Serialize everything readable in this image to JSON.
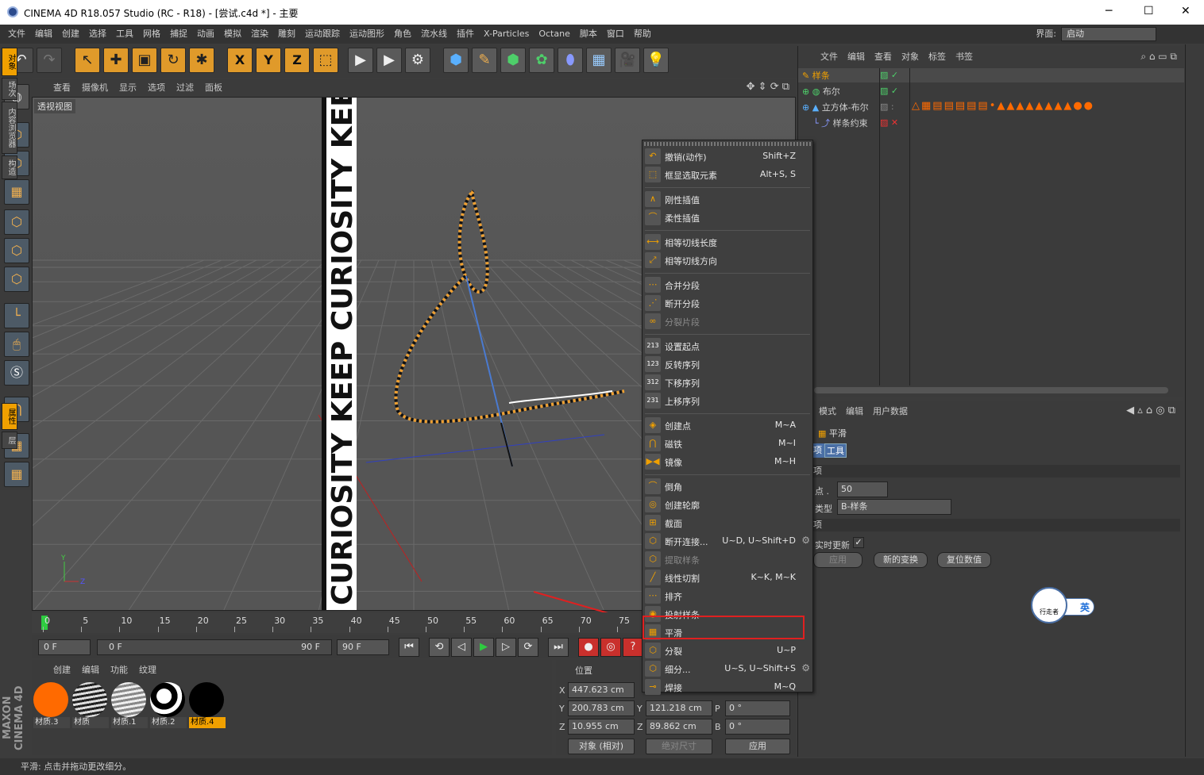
{
  "window": {
    "title": "CINEMA 4D R18.057 Studio (RC - R18) - [尝试.c4d *] - 主要",
    "min": "─",
    "max": "☐",
    "close": "✕"
  },
  "menu": [
    "文件",
    "编辑",
    "创建",
    "选择",
    "工具",
    "网格",
    "捕捉",
    "动画",
    "模拟",
    "渲染",
    "雕刻",
    "运动跟踪",
    "运动图形",
    "角色",
    "流水线",
    "插件",
    "X-Particles",
    "Octane",
    "脚本",
    "窗口",
    "帮助"
  ],
  "interface": {
    "label": "界面:",
    "value": "启动"
  },
  "toolbar": {
    "undo": "↶",
    "redo": "↷",
    "x": "X",
    "y": "Y",
    "z": "Z"
  },
  "viewport_menu": [
    "查看",
    "摄像机",
    "显示",
    "选项",
    "过滤",
    "面板"
  ],
  "viewport_label": "透视视图",
  "viewport_text": "CURIOSITY KEEP CURIOSITY KEEP CU",
  "timeline": {
    "ticks": [
      "0",
      "5",
      "10",
      "15",
      "20",
      "25",
      "30",
      "35",
      "40",
      "45",
      "50",
      "55",
      "60",
      "65",
      "70",
      "75"
    ]
  },
  "transport": {
    "current": "0 F",
    "start": "0 F",
    "end_slider": "90 F",
    "end": "90 F"
  },
  "materials": {
    "menu": [
      "创建",
      "编辑",
      "功能",
      "纹理"
    ],
    "items": [
      {
        "name": "材质.3",
        "color": "#ff6a00"
      },
      {
        "name": "材质",
        "color": "stripes"
      },
      {
        "name": "材质.1",
        "color": "stripes-light"
      },
      {
        "name": "材质.2",
        "color": "bw"
      },
      {
        "name": "材质.4",
        "color": "#000000",
        "selected": true
      }
    ]
  },
  "coords": {
    "header": "位置",
    "x": "447.623 cm",
    "y": "200.783 cm",
    "z": "10.955 cm",
    "sy": "121.218 cm",
    "sz": "89.862 cm",
    "p": "0 °",
    "b": "0 °",
    "mode": "对象 (相对)",
    "size_mode": "绝对尺寸",
    "apply": "应用",
    "labels": {
      "x": "X",
      "y": "Y",
      "z": "Z",
      "p": "P",
      "b": "B"
    }
  },
  "status": "平滑: 点击并拖动更改细分。",
  "maxon": "MAXON CINEMA 4D",
  "objects": {
    "menu": [
      "文件",
      "编辑",
      "查看",
      "对象",
      "标签",
      "书签"
    ],
    "items": [
      {
        "name": "样条"
      },
      {
        "name": "布尔"
      },
      {
        "name": "立方体-布尔"
      },
      {
        "name": "样条约束"
      }
    ]
  },
  "attributes": {
    "menu": [
      "模式",
      "编辑",
      "用户数据"
    ],
    "title": "平滑",
    "tabs": [
      "项",
      "工具"
    ],
    "section1": "项",
    "points_label": "点 .",
    "points_value": "50",
    "type_label": "类型",
    "type_value": "B-样条",
    "section2": "项",
    "realtime": "实时更新",
    "check": "✓",
    "apply": "应用",
    "new_transform": "新的变换",
    "reset": "复位数值"
  },
  "right_tabs": [
    "对象",
    "场次",
    "内容浏览器",
    "构造",
    "属性",
    "层"
  ],
  "ime": {
    "logo": "行走者",
    "lang": "英"
  },
  "context_menu": [
    {
      "label": "撤销(动作)",
      "shortcut": "Shift+Z",
      "icon": "↶"
    },
    {
      "label": "框显选取元素",
      "shortcut": "Alt+S, S",
      "icon": "⬚"
    },
    {
      "sep": true
    },
    {
      "label": "刚性插值",
      "shortcut": "",
      "icon": "∧"
    },
    {
      "label": "柔性插值",
      "shortcut": "",
      "icon": "⌒"
    },
    {
      "sep": true
    },
    {
      "label": "相等切线长度",
      "shortcut": "",
      "icon": "⟷"
    },
    {
      "label": "相等切线方向",
      "shortcut": "",
      "icon": "⤢"
    },
    {
      "sep": true
    },
    {
      "label": "合并分段",
      "shortcut": "",
      "icon": "⋯"
    },
    {
      "label": "断开分段",
      "shortcut": "",
      "icon": "⋰"
    },
    {
      "label": "分裂片段",
      "shortcut": "",
      "icon": "∞",
      "disabled": true
    },
    {
      "sep": true
    },
    {
      "label": "设置起点",
      "shortcut": "",
      "icon": "213"
    },
    {
      "label": "反转序列",
      "shortcut": "",
      "icon": "123"
    },
    {
      "label": "下移序列",
      "shortcut": "",
      "icon": "312"
    },
    {
      "label": "上移序列",
      "shortcut": "",
      "icon": "231"
    },
    {
      "sep": true
    },
    {
      "label": "创建点",
      "shortcut": "M~A",
      "icon": "◈"
    },
    {
      "label": "磁铁",
      "shortcut": "M~I",
      "icon": "⋂"
    },
    {
      "label": "镜像",
      "shortcut": "M~H",
      "icon": "▶◀"
    },
    {
      "sep": true
    },
    {
      "label": "倒角",
      "shortcut": "",
      "icon": "⌒"
    },
    {
      "label": "创建轮廓",
      "shortcut": "",
      "icon": "◎"
    },
    {
      "label": "截面",
      "shortcut": "",
      "icon": "⊞"
    },
    {
      "label": "断开连接...",
      "shortcut": "U~D, U~Shift+D",
      "icon": "⬡",
      "gear": true
    },
    {
      "label": "提取样条",
      "shortcut": "",
      "icon": "⬡",
      "disabled": true
    },
    {
      "label": "线性切割",
      "shortcut": "K~K, M~K",
      "icon": "╱"
    },
    {
      "label": "排齐",
      "shortcut": "",
      "icon": "⋯"
    },
    {
      "label": "投射样条",
      "shortcut": "",
      "icon": "◉"
    },
    {
      "label": "平滑",
      "shortcut": "",
      "icon": "▦"
    },
    {
      "label": "分裂",
      "shortcut": "U~P",
      "icon": "⬡"
    },
    {
      "label": "细分...",
      "shortcut": "U~S, U~Shift+S",
      "icon": "⬡",
      "gear": true
    },
    {
      "label": "焊接",
      "shortcut": "M~Q",
      "icon": "⊸"
    }
  ]
}
